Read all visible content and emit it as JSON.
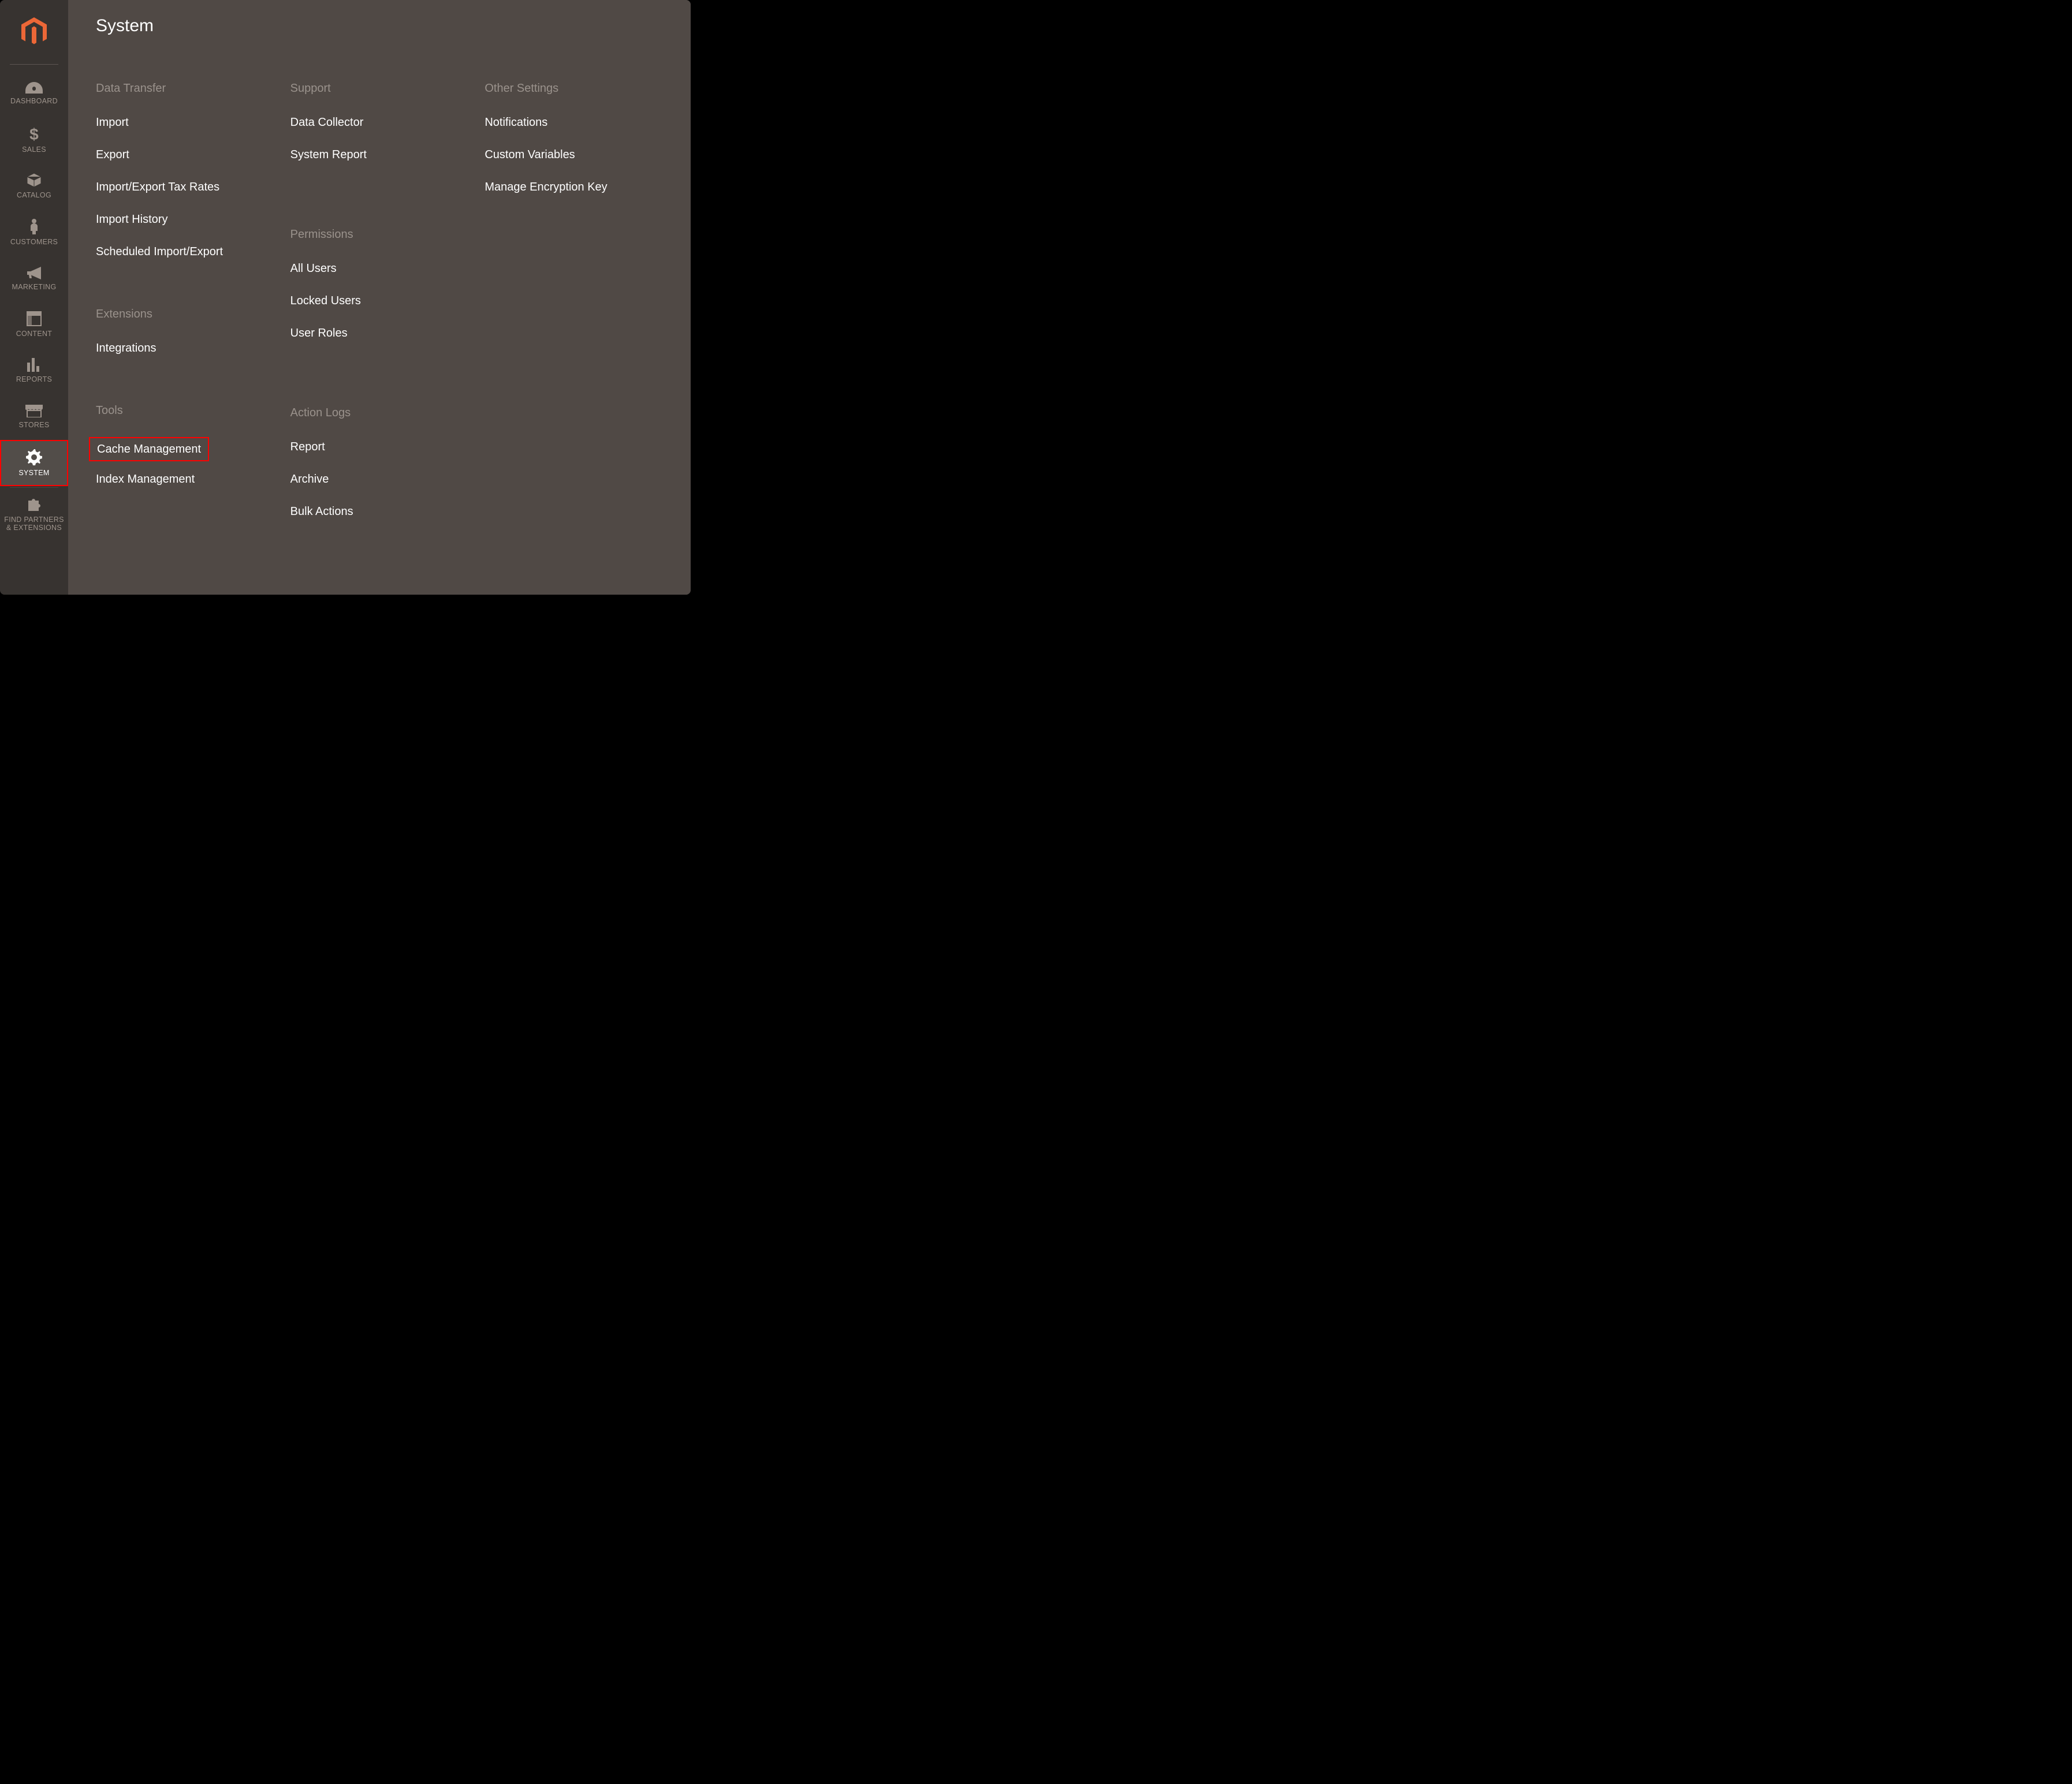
{
  "sidebar": {
    "items": [
      {
        "label": "DASHBOARD",
        "icon": "dashboard-icon",
        "active": false,
        "highlight": false
      },
      {
        "label": "SALES",
        "icon": "dollar-icon",
        "active": false,
        "highlight": false
      },
      {
        "label": "CATALOG",
        "icon": "box-icon",
        "active": false,
        "highlight": false
      },
      {
        "label": "CUSTOMERS",
        "icon": "person-icon",
        "active": false,
        "highlight": false
      },
      {
        "label": "MARKETING",
        "icon": "megaphone-icon",
        "active": false,
        "highlight": false
      },
      {
        "label": "CONTENT",
        "icon": "layout-icon",
        "active": false,
        "highlight": false
      },
      {
        "label": "REPORTS",
        "icon": "bars-icon",
        "active": false,
        "highlight": false
      },
      {
        "label": "STORES",
        "icon": "storefront-icon",
        "active": false,
        "highlight": false
      },
      {
        "label": "SYSTEM",
        "icon": "gear-icon",
        "active": true,
        "highlight": true
      },
      {
        "label": "FIND PARTNERS & EXTENSIONS",
        "icon": "puzzle-icon",
        "active": false,
        "highlight": false
      }
    ]
  },
  "flyout": {
    "title": "System",
    "columns": [
      {
        "groups": [
          {
            "title": "Data Transfer",
            "links": [
              {
                "label": "Import"
              },
              {
                "label": "Export"
              },
              {
                "label": "Import/Export Tax Rates"
              },
              {
                "label": "Import History"
              },
              {
                "label": "Scheduled Import/Export"
              }
            ]
          },
          {
            "title": "Extensions",
            "links": [
              {
                "label": "Integrations"
              }
            ]
          },
          {
            "title": "Tools",
            "links": [
              {
                "label": "Cache Management",
                "highlight": true
              },
              {
                "label": "Index Management"
              }
            ]
          }
        ]
      },
      {
        "groups": [
          {
            "title": "Support",
            "links": [
              {
                "label": "Data Collector"
              },
              {
                "label": "System Report"
              }
            ]
          },
          {
            "title": "Permissions",
            "links": [
              {
                "label": "All Users"
              },
              {
                "label": "Locked Users"
              },
              {
                "label": "User Roles"
              }
            ]
          },
          {
            "title": "Action Logs",
            "links": [
              {
                "label": "Report"
              },
              {
                "label": "Archive"
              },
              {
                "label": "Bulk Actions"
              }
            ]
          }
        ]
      },
      {
        "groups": [
          {
            "title": "Other Settings",
            "links": [
              {
                "label": "Notifications"
              },
              {
                "label": "Custom Variables"
              },
              {
                "label": "Manage Encryption Key"
              }
            ]
          }
        ]
      }
    ]
  }
}
